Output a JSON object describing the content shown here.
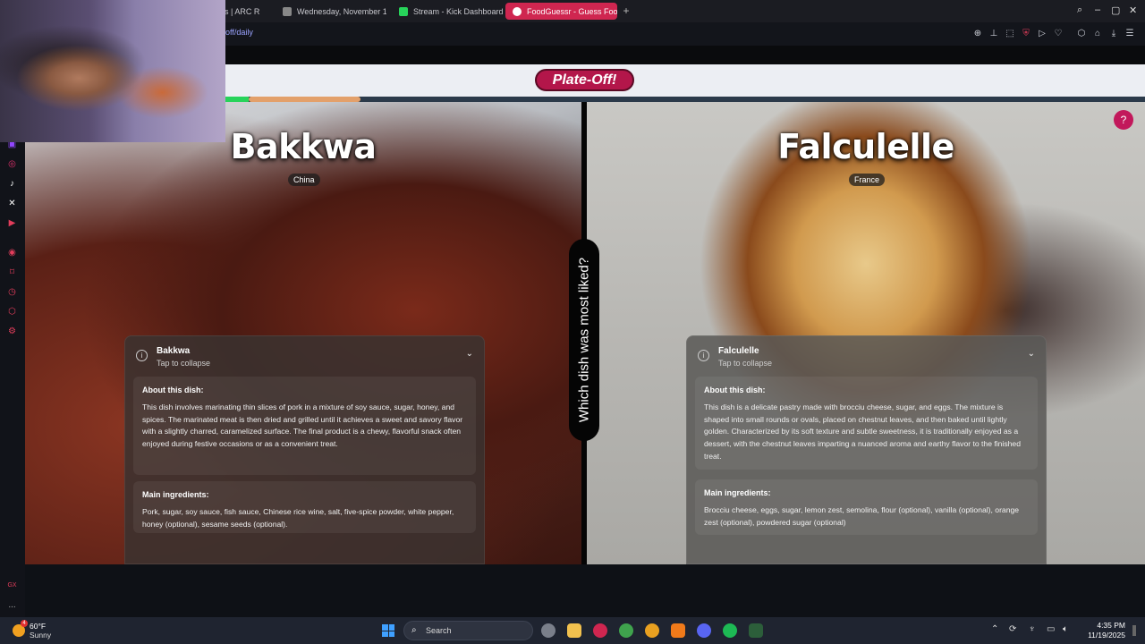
{
  "browser": {
    "tabs": [
      {
        "label": "les | ARC R",
        "color": "#4a6fa5"
      },
      {
        "label": "Wednesday, November 1",
        "color": "#888888"
      },
      {
        "label": "Stream - Kick Dashboard",
        "color": "#27d35a"
      },
      {
        "label": "FoodGuessr - Guess Food",
        "color": "#ffffff",
        "active": true
      }
    ],
    "url": "off/daily",
    "accent": "#cf2650"
  },
  "page": {
    "logo": "Plate-Off!",
    "question": "Which dish was most liked?",
    "help_icon": "?"
  },
  "dishes": {
    "left": {
      "name": "Bakkwa",
      "origin": "China",
      "card": {
        "title": "Bakkwa",
        "subtitle": "Tap to collapse",
        "about_title": "About this dish:",
        "about_text": "This dish involves marinating thin slices of pork in a mixture of soy sauce, sugar, honey, and spices. The marinated meat is then dried and grilled until it achieves a sweet and savory flavor with a slightly charred, caramelized surface. The final product is a chewy, flavorful snack often enjoyed during festive occasions or as a convenient treat.",
        "ingredients_title": "Main ingredients:",
        "ingredients_text": "Pork, sugar, soy sauce, fish sauce, Chinese rice wine, salt, five-spice powder, white pepper, honey (optional), sesame seeds (optional)."
      }
    },
    "right": {
      "name": "Falculelle",
      "origin": "France",
      "card": {
        "title": "Falculelle",
        "subtitle": "Tap to collapse",
        "about_title": "About this dish:",
        "about_text": "This dish is a delicate pastry made with brocciu cheese, sugar, and eggs. The mixture is shaped into small rounds or ovals, placed on chestnut leaves, and then baked until lightly golden. Characterized by its soft texture and subtle sweetness, it is traditionally enjoyed as a dessert, with the chestnut leaves imparting a nuanced aroma and earthy flavor to the finished treat.",
        "ingredients_title": "Main ingredients:",
        "ingredients_text": "Brocciu cheese, eggs, sugar, lemon zest, semolina, flour (optional), vanilla (optional), orange zest (optional), powdered sugar (optional)"
      }
    }
  },
  "sidebar": {
    "gx_label": "GX",
    "more_label": "..."
  },
  "taskbar": {
    "weather_temp": "60°F",
    "weather_desc": "Sunny",
    "weather_badge": "4",
    "search_label": "Search",
    "time": "4:35 PM",
    "date": "11/19/2025"
  }
}
